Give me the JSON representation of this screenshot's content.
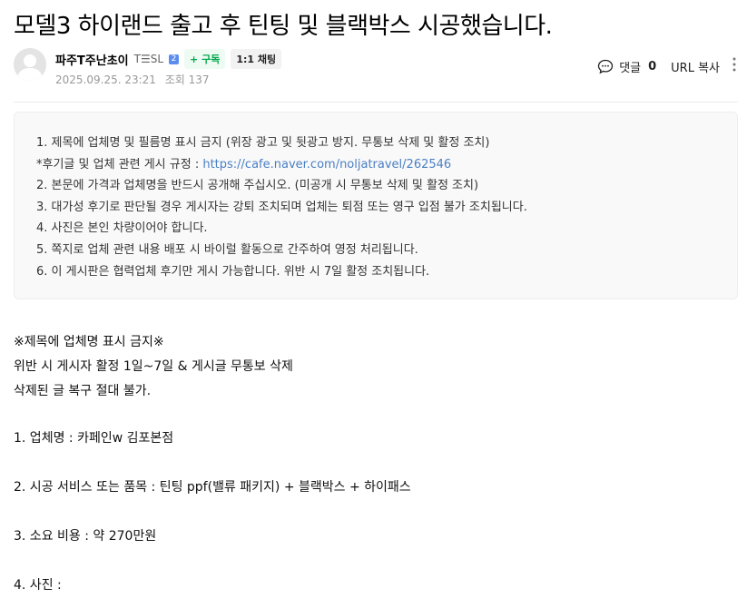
{
  "post": {
    "title": "모델3 하이랜드 출고 후 틴팅 및 블랙박스 시공했습니다."
  },
  "author": {
    "name": "파주T주난초이",
    "level_text": "T☰SL",
    "level_badge": "2",
    "subscribe_label": "+ 구독",
    "chat_label": "1:1 채팅",
    "date": "2025.09.25. 23:21",
    "views": "조회 137"
  },
  "tools": {
    "comment_label": "댓글",
    "comment_count": "0",
    "url_copy_label": "URL 복사"
  },
  "notice": {
    "line1": "1. 제목에 업체명 및 필름명 표시 금지 (위장 광고 및 뒷광고 방지. 무통보 삭제 및 활정 조치)",
    "line2_prefix": "*후기글 및 업체 관련 게시 규정 : ",
    "line2_link": "https://cafe.naver.com/noljatravel/262546",
    "line3": "2. 본문에 가격과 업체명을 반드시 공개해 주십시오. (미공개 시 무통보 삭제 및 활정 조치)",
    "line4": "3. 대가성 후기로 판단될 경우 게시자는 강퇴 조치되며 업체는 퇴점 또는 영구 입점 불가 조치됩니다.",
    "line5": "4. 사진은 본인 차량이어야 합니다.",
    "line6": "5. 쪽지로 업체 관련 내용 배포 시 바이럴 활동으로 간주하여 영정 처리됩니다.",
    "line7": "6. 이 게시판은 협력업체 후기만 게시 가능합니다. 위반 시 7일 활정 조치됩니다."
  },
  "body": {
    "rule_title": "※제목에 업체명 표시 금지※",
    "rule_line1": "위반 시 게시자 활정 1일~7일 & 게시글 무통보 삭제",
    "rule_line2": "삭제된 글 복구 절대 불가.",
    "item1": "1. 업체명 :  카페인w 김포본점",
    "item2": "2. 시공 서비스 또는 품목 :  틴팅 ppf(밸류 패키지) + 블랙박스 + 하이패스",
    "item3": "3. 소요 비용 :  약 270만원",
    "item4": "4. 사진 :"
  }
}
